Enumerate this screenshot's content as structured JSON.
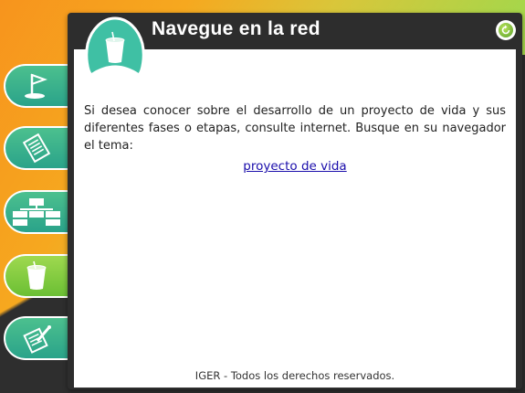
{
  "window": {
    "title": "Navegue en la red"
  },
  "content": {
    "paragraph": "Si desea conocer sobre el desarrollo de un proyecto de vida y sus diferentes fases o etapas, consulte internet. Busque en su navegador el tema:",
    "link_text": "proyecto de vida",
    "footer": "IGER - Todos los derechos reservados."
  },
  "sidebar": {
    "items": [
      {
        "icon": "golf-flag-icon"
      },
      {
        "icon": "checklist-icon"
      },
      {
        "icon": "org-chart-icon"
      },
      {
        "icon": "cup-icon",
        "active": true
      },
      {
        "icon": "pencil-note-icon"
      }
    ]
  },
  "colors": {
    "accent_teal": "#2aa38a",
    "accent_green": "#8fd24e",
    "title_bar": "#2d2d2d",
    "link": "#1a0dab"
  }
}
